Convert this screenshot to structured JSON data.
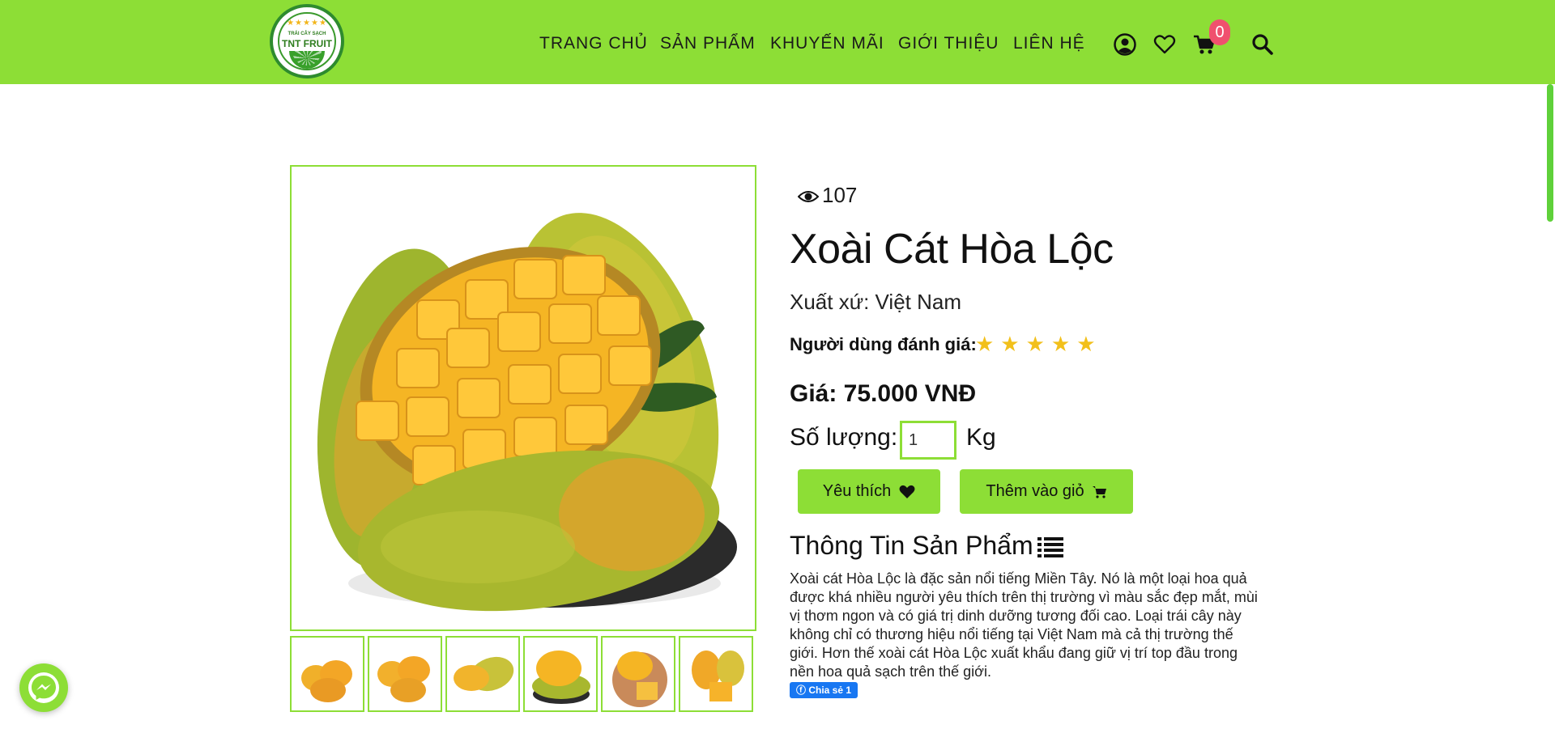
{
  "header": {
    "logo": {
      "stars": "★★★★★",
      "small_text": "TRÁI CÂY SẠCH",
      "brand_text": "TNT FRUIT"
    },
    "nav": [
      {
        "label": "TRANG CHỦ"
      },
      {
        "label": "SẢN PHẨM"
      },
      {
        "label": "KHUYẾN MÃI"
      },
      {
        "label": "GIỚI THIỆU"
      },
      {
        "label": "LIÊN HỆ"
      }
    ],
    "icons": [
      "user-icon",
      "heart-icon",
      "cart-icon",
      "search-icon"
    ],
    "cart_count": "0",
    "colors": {
      "bar": "#8dde36",
      "badge": "#f0506e"
    }
  },
  "product": {
    "views": "107",
    "title": "Xoài Cát Hòa Lộc",
    "origin": "Xuất xứ: Việt Nam",
    "rating_label": "Người dùng đánh giá:",
    "rating_stars": 5,
    "stars_text": "★★★★★",
    "price": "Giá: 75.000 VNĐ",
    "quantity_label": "Số lượng:",
    "quantity_value": "1",
    "quantity_unit": "Kg",
    "favorite_label": "Yêu thích",
    "add_cart_label": "Thêm vào giỏ",
    "info_title": "Thông Tin Sản Phẩm",
    "description": "Xoài cát Hòa Lộc là đặc sản nổi tiếng Miền Tây. Nó là một loại hoa quả được khá nhiều người yêu thích trên thị trường vì màu sắc đẹp mắt, mùi vị thơm ngon và có giá trị dinh dưỡng tương đối cao. Loại trái cây này không chỉ có thương hiệu nổi tiếng tại Việt Nam mà cả thị trường thế giới. Hơn thế xoài cát Hòa Lộc xuất khẩu đang giữ vị trí top đầu trong nền hoa quả sạch trên thế giới.",
    "share_label": "Chia sẻ 1",
    "thumbnails": [
      "thumb-1",
      "thumb-2",
      "thumb-3",
      "thumb-4",
      "thumb-5",
      "thumb-6"
    ]
  },
  "accent_color": "#8dde36",
  "star_color": "#f2c01b"
}
